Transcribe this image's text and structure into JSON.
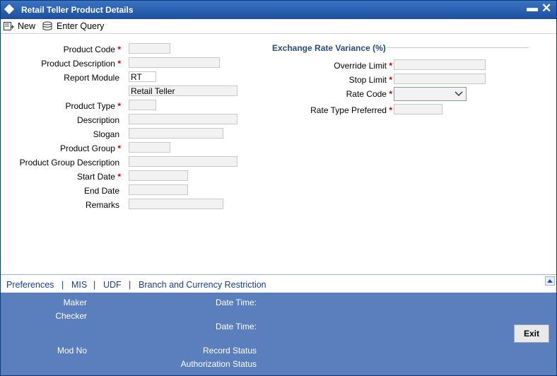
{
  "window": {
    "title": "Retail Teller Product Details",
    "minimize_label": "▬",
    "close_label": "✕"
  },
  "toolbar": {
    "new_label": "New",
    "enter_query_label": "Enter Query"
  },
  "form": {
    "required_mark": "*",
    "product_code": {
      "label": "Product Code",
      "value": ""
    },
    "product_description": {
      "label": "Product Description",
      "value": ""
    },
    "report_module": {
      "label": "Report Module",
      "value": "RT",
      "description": "Retail Teller"
    },
    "product_type": {
      "label": "Product Type",
      "value": ""
    },
    "description": {
      "label": "Description",
      "value": ""
    },
    "slogan": {
      "label": "Slogan",
      "value": ""
    },
    "product_group": {
      "label": "Product Group",
      "value": ""
    },
    "product_group_description": {
      "label": "Product Group Description",
      "value": ""
    },
    "start_date": {
      "label": "Start Date",
      "value": ""
    },
    "end_date": {
      "label": "End Date",
      "value": ""
    },
    "remarks": {
      "label": "Remarks",
      "value": ""
    }
  },
  "exchange": {
    "section_title": "Exchange Rate Variance (%)",
    "override_limit": {
      "label": "Override Limit",
      "value": ""
    },
    "stop_limit": {
      "label": "Stop Limit",
      "value": ""
    },
    "rate_code": {
      "label": "Rate Code",
      "value": ""
    },
    "rate_type_preferred": {
      "label": "Rate Type Preferred",
      "value": ""
    }
  },
  "tabs": {
    "preferences": "Preferences",
    "mis": "MIS",
    "udf": "UDF",
    "branch_currency": "Branch and Currency Restriction",
    "separator": "|"
  },
  "footer": {
    "maker": "Maker",
    "checker": "Checker",
    "mod_no": "Mod No",
    "date_time_1": "Date Time:",
    "date_time_2": "Date Time:",
    "record_status": "Record Status",
    "authorization_status": "Authorization Status",
    "exit_label": "Exit"
  },
  "colors": {
    "titlebar": "#1d4f9e",
    "footer": "#5b7ebd",
    "required": "#cc0000",
    "link": "#1a3e8c"
  }
}
